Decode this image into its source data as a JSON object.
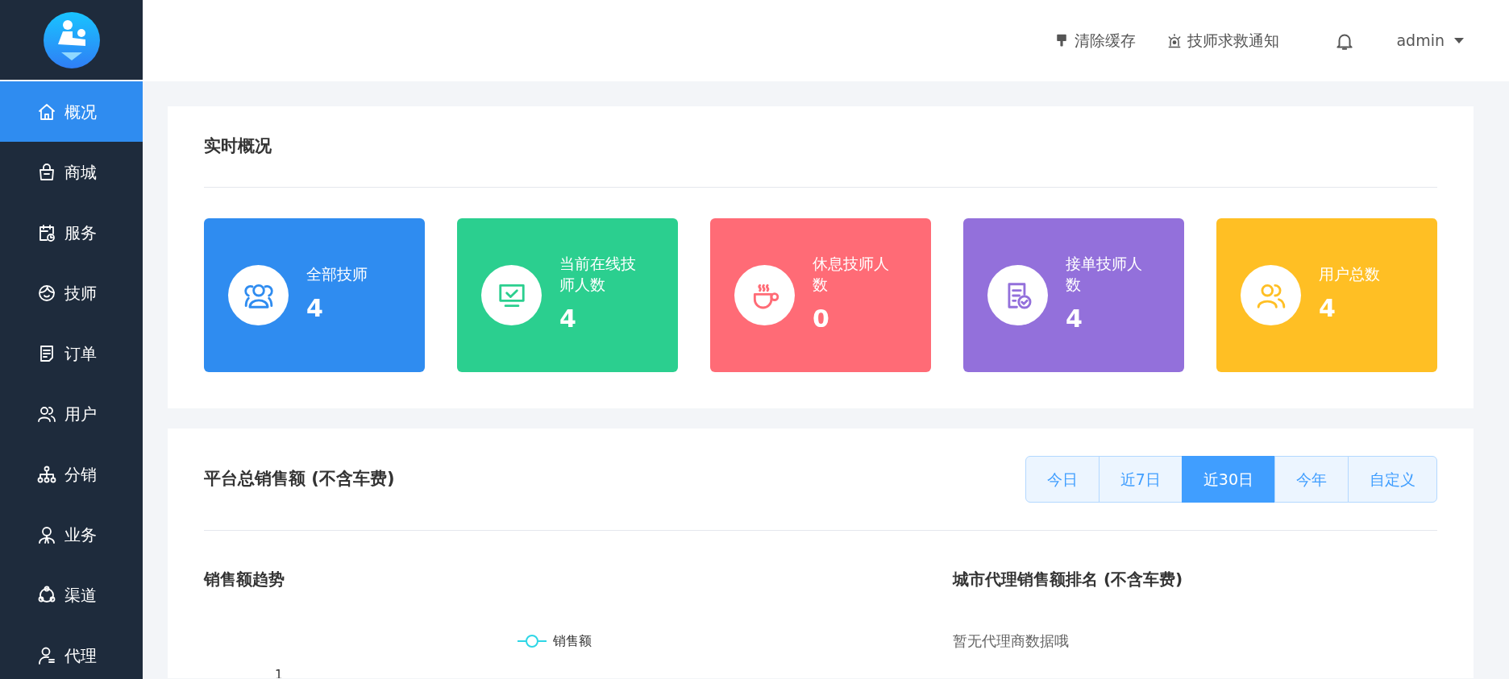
{
  "sidebar": {
    "items": [
      {
        "label": "概况",
        "selected": true
      },
      {
        "label": "商城",
        "selected": false
      },
      {
        "label": "服务",
        "selected": false
      },
      {
        "label": "技师",
        "selected": false
      },
      {
        "label": "订单",
        "selected": false
      },
      {
        "label": "用户",
        "selected": false
      },
      {
        "label": "分销",
        "selected": false
      },
      {
        "label": "业务",
        "selected": false
      },
      {
        "label": "渠道",
        "selected": false
      },
      {
        "label": "代理",
        "selected": false
      }
    ]
  },
  "header": {
    "actions": [
      {
        "label": "清除缓存"
      },
      {
        "label": "技师求救通知"
      }
    ],
    "user": "admin"
  },
  "overview": {
    "title": "实时概况",
    "stats": [
      {
        "label": "全部技师",
        "value": "4",
        "color": "#2f8cf0"
      },
      {
        "label": "当前在线技师人数",
        "value": "4",
        "color": "#2bcf8f"
      },
      {
        "label": "休息技师人数",
        "value": "0",
        "color": "#ff6b76"
      },
      {
        "label": "接单技师人数",
        "value": "4",
        "color": "#9370db"
      },
      {
        "label": "用户总数",
        "value": "4",
        "color": "#ffbf24"
      }
    ]
  },
  "sales": {
    "title": "平台总销售额 (不含车费)",
    "ranges": [
      {
        "label": "今日",
        "selected": false
      },
      {
        "label": "近7日",
        "selected": false
      },
      {
        "label": "近30日",
        "selected": true
      },
      {
        "label": "今年",
        "selected": false
      },
      {
        "label": "自定义",
        "selected": false
      }
    ],
    "trend": {
      "title": "销售额趋势",
      "legend": "销售额",
      "axis_label": "1"
    },
    "ranking": {
      "title": "城市代理销售额排名 (不含车费)",
      "empty_text": "暂无代理商数据哦"
    }
  }
}
